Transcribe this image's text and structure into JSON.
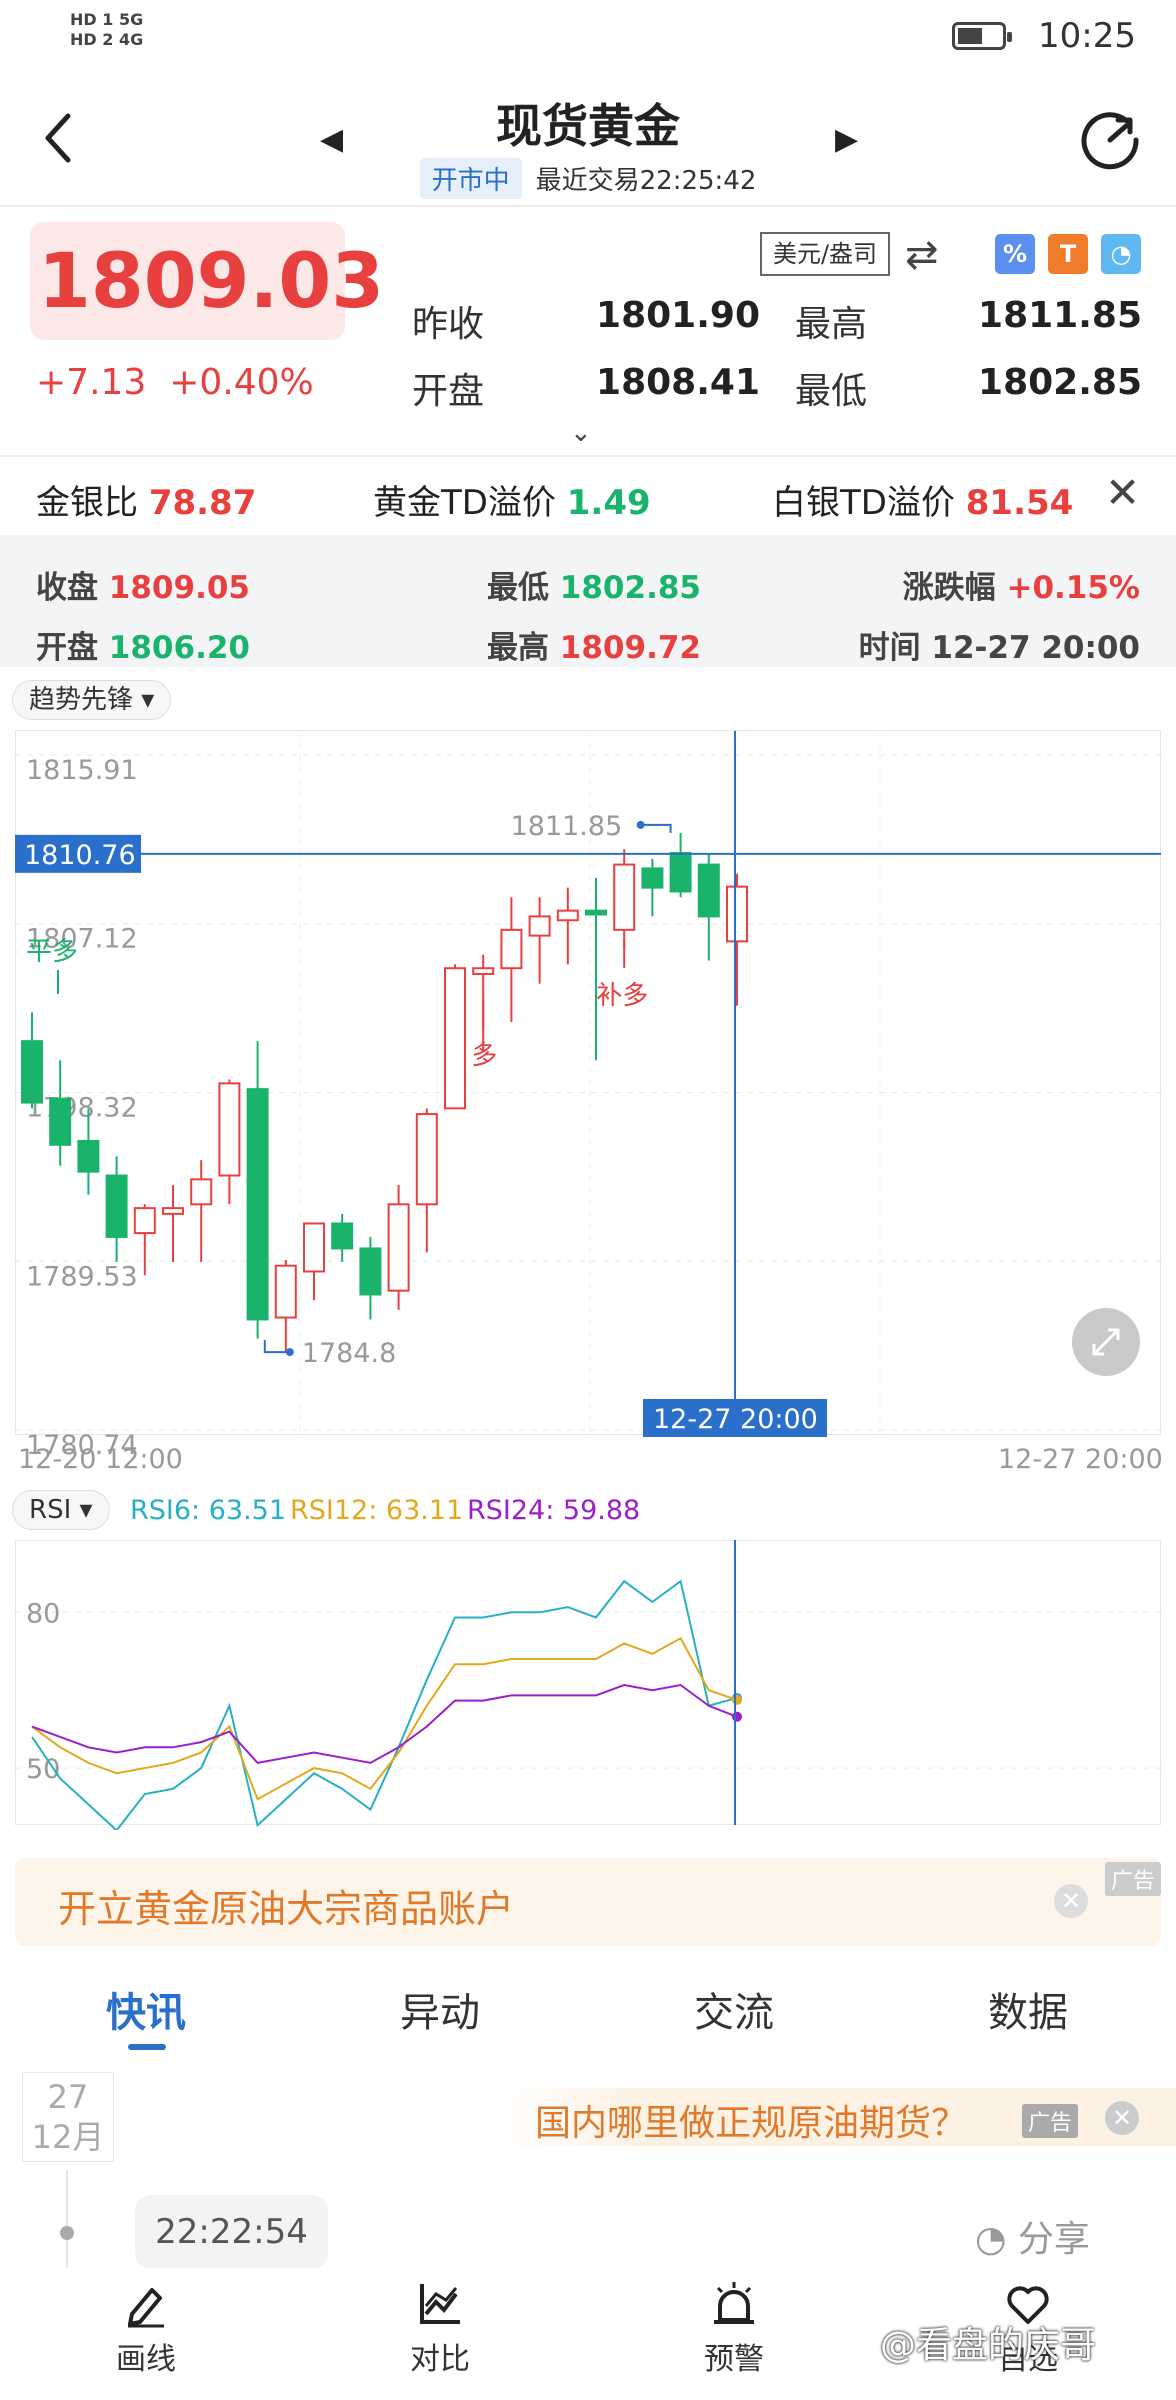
{
  "status_bar": {
    "network_left": "HD 1  5G",
    "network_left2": "HD 2  4G",
    "time": "10:25"
  },
  "header": {
    "title": "现货黄金",
    "market_status": "开市中",
    "last_trade": "最近交易22:25:42"
  },
  "quote": {
    "price": "1809.03",
    "change": "+7.13",
    "change_pct": "+0.40%",
    "unit": "美元/盎司",
    "prev_close_label": "昨收",
    "prev_close": "1801.90",
    "high_label": "最高",
    "high": "1811.85",
    "open_label": "开盘",
    "open": "1808.41",
    "low_label": "最低",
    "low": "1802.85"
  },
  "ratios": {
    "gold_silver_label": "金银比",
    "gold_silver": "78.87",
    "gold_td_label": "黄金TD溢价",
    "gold_td": "1.49",
    "silver_td_label": "白银TD溢价",
    "silver_td": "81.54"
  },
  "ohlc": {
    "close_label": "收盘",
    "close": "1809.05",
    "low_label": "最低",
    "low": "1802.85",
    "change_label": "涨跌幅",
    "change": "+0.15%",
    "open_label": "开盘",
    "open": "1806.20",
    "high_label": "最高",
    "high": "1809.72",
    "time_label": "时间",
    "time": "12-27 20:00"
  },
  "indicator_pill": "趋势先锋 ▾",
  "rsi_pill": "RSI ▾",
  "rsi_legend": {
    "rsi6": "RSI6: 63.51",
    "rsi12": "RSI12: 63.11",
    "rsi24": "RSI24: 59.88"
  },
  "ad_banner": {
    "text": "开立黄金原油大宗商品账户",
    "tag": "广告"
  },
  "tabs": [
    "快讯",
    "异动",
    "交流",
    "数据"
  ],
  "news": {
    "day": "27",
    "month": "12月",
    "ad_text": "国内哪里做正规原油期货？",
    "ad_tag": "广告",
    "time": "22:22:54",
    "share": "分享"
  },
  "bottom_nav": [
    "画线",
    "对比",
    "预警",
    "自选"
  ],
  "watermark": "@看盘的庆哥",
  "colors": {
    "up": "#e8403f",
    "down": "#19b36b",
    "accent": "#2a6fc9",
    "rsi6": "#26b0c4",
    "rsi12": "#e3a81c",
    "rsi24": "#9b1fc9"
  },
  "chart_data": [
    {
      "type": "candlestick",
      "title": "",
      "ylim": [
        1780.74,
        1815.91
      ],
      "y_ticks": [
        "1815.91",
        "1807.12",
        "1798.32",
        "1789.53",
        "1780.74"
      ],
      "x_ticks": [
        "12-20 12:00",
        "12-27 20:00"
      ],
      "crosshair": {
        "price": "1810.76",
        "time": "12-27 20:00"
      },
      "annotations": {
        "max": "1811.85",
        "min": "1784.8",
        "signals": [
          "平多",
          "多",
          "补多"
        ]
      },
      "candles": [
        {
          "o": 1801.0,
          "h": 1802.5,
          "l": 1797.5,
          "c": 1797.8
        },
        {
          "o": 1798.0,
          "h": 1800.0,
          "l": 1794.5,
          "c": 1795.6
        },
        {
          "o": 1795.8,
          "h": 1797.5,
          "l": 1793.0,
          "c": 1794.2
        },
        {
          "o": 1794.0,
          "h": 1795.0,
          "l": 1789.5,
          "c": 1790.8
        },
        {
          "o": 1791.0,
          "h": 1792.5,
          "l": 1788.8,
          "c": 1792.3
        },
        {
          "o": 1792.0,
          "h": 1793.5,
          "l": 1789.5,
          "c": 1792.3
        },
        {
          "o": 1792.5,
          "h": 1794.8,
          "l": 1789.5,
          "c": 1793.8
        },
        {
          "o": 1794.0,
          "h": 1799.0,
          "l": 1792.5,
          "c": 1798.8
        },
        {
          "o": 1798.5,
          "h": 1801.0,
          "l": 1785.5,
          "c": 1786.5
        },
        {
          "o": 1786.6,
          "h": 1789.6,
          "l": 1784.8,
          "c": 1789.3
        },
        {
          "o": 1789.0,
          "h": 1791.5,
          "l": 1787.5,
          "c": 1791.5
        },
        {
          "o": 1791.5,
          "h": 1792.0,
          "l": 1789.5,
          "c": 1790.2
        },
        {
          "o": 1790.2,
          "h": 1790.8,
          "l": 1786.5,
          "c": 1787.8
        },
        {
          "o": 1788.0,
          "h": 1793.5,
          "l": 1787.0,
          "c": 1792.5
        },
        {
          "o": 1792.5,
          "h": 1797.5,
          "l": 1790.0,
          "c": 1797.2
        },
        {
          "o": 1797.5,
          "h": 1805.0,
          "l": 1797.5,
          "c": 1804.8
        },
        {
          "o": 1804.5,
          "h": 1805.5,
          "l": 1800.5,
          "c": 1804.8
        },
        {
          "o": 1804.8,
          "h": 1808.5,
          "l": 1802.0,
          "c": 1806.8
        },
        {
          "o": 1806.5,
          "h": 1808.5,
          "l": 1804.0,
          "c": 1807.5
        },
        {
          "o": 1807.3,
          "h": 1809.0,
          "l": 1805.0,
          "c": 1807.8
        },
        {
          "o": 1807.8,
          "h": 1809.5,
          "l": 1800.0,
          "c": 1807.6
        },
        {
          "o": 1806.8,
          "h": 1811.0,
          "l": 1805.8,
          "c": 1810.2
        },
        {
          "o": 1810.0,
          "h": 1810.5,
          "l": 1807.5,
          "c": 1809.0
        },
        {
          "o": 1810.8,
          "h": 1811.85,
          "l": 1808.5,
          "c": 1808.8
        },
        {
          "o": 1810.2,
          "h": 1810.8,
          "l": 1805.2,
          "c": 1807.5
        },
        {
          "o": 1806.2,
          "h": 1809.72,
          "l": 1802.85,
          "c": 1809.05
        }
      ]
    },
    {
      "type": "line",
      "title": "RSI",
      "ylim": [
        40,
        92
      ],
      "y_ticks": [
        "80",
        "50"
      ],
      "series": [
        {
          "name": "RSI6",
          "values": [
            56,
            48,
            43,
            38,
            45,
            46,
            50,
            62,
            39,
            44,
            49,
            46,
            42,
            54,
            67,
            79,
            79,
            80,
            80,
            81,
            79,
            86,
            82,
            86,
            62,
            63.51
          ]
        },
        {
          "name": "RSI12",
          "values": [
            58,
            54,
            51,
            49,
            50,
            51,
            53,
            58,
            44,
            47,
            50,
            49,
            46,
            53,
            62,
            70,
            70,
            71,
            71,
            71,
            71,
            74,
            72,
            75,
            65,
            63.11
          ]
        },
        {
          "name": "RSI24",
          "values": [
            58,
            56,
            54,
            53,
            54,
            54,
            55,
            57,
            51,
            52,
            53,
            52,
            51,
            54,
            58,
            63,
            63,
            64,
            64,
            64,
            64,
            66,
            65,
            66,
            62,
            59.88
          ]
        }
      ]
    }
  ]
}
